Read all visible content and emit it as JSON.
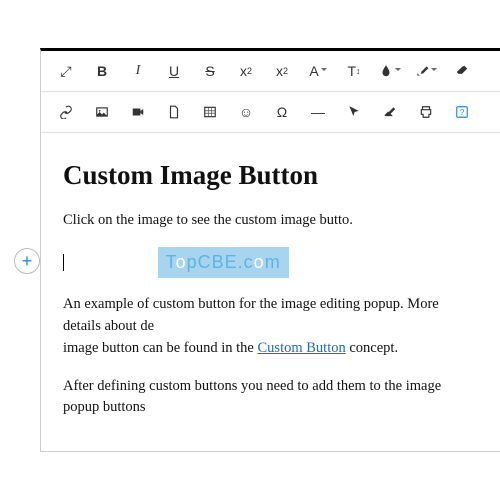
{
  "toolbar": {
    "fullscreen": "⤢",
    "bold": "B",
    "italic": "I",
    "underline": "U",
    "strike": "S",
    "sub_base": "x",
    "sub_s": "2",
    "sup_base": "x",
    "sup_s": "2",
    "font_family": "A",
    "font_size": "T",
    "font_size_sub": "↕",
    "color_drop": "⬤",
    "link": "🔗",
    "emoji": "☺",
    "omega": "Ω",
    "minus": "—",
    "cursor_arrow": "➤",
    "print": "⎙"
  },
  "content": {
    "heading": "Custom Image Button",
    "p1": "Click on the image to see the custom image butto.",
    "p2a": "An example of custom button for the image editing popup. More details about de",
    "p2b": "image button can be found in the ",
    "p2c": " concept.",
    "link": "Custom Button",
    "p3": "After defining custom buttons you need to add them to the image popup buttons"
  },
  "watermark": {
    "a": "T",
    "b": "o",
    "c": "pCBE.c",
    "d": "o",
    "e": "m"
  },
  "add": "+"
}
